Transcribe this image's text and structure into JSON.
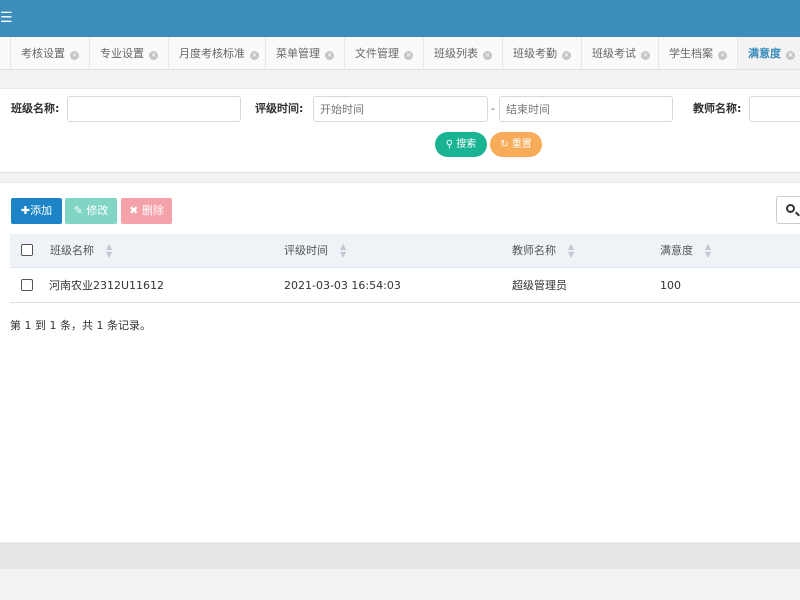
{
  "topbar": {
    "menu_icon": "☰"
  },
  "tabs": [
    {
      "label": "考核设置"
    },
    {
      "label": "专业设置"
    },
    {
      "label": "月度考核标准"
    },
    {
      "label": "菜单管理"
    },
    {
      "label": "文件管理"
    },
    {
      "label": "班级列表"
    },
    {
      "label": "班级考勤"
    },
    {
      "label": "班级考试"
    },
    {
      "label": "学生档案"
    },
    {
      "label": "满意度"
    }
  ],
  "search": {
    "class_name_label": "班级名称:",
    "class_name_value": "",
    "rating_time_label": "评级时间:",
    "start_placeholder": "开始时间",
    "separator": "-",
    "end_placeholder": "结束时间",
    "teacher_label": "教师名称:",
    "teacher_value": "",
    "search_button": "搜索",
    "reset_button": "重置"
  },
  "toolbar": {
    "add_label": "添加",
    "edit_label": "修改",
    "delete_label": "删除"
  },
  "table": {
    "columns": [
      "班级名称",
      "评级时间",
      "教师名称",
      "满意度"
    ],
    "rows": [
      {
        "class_name": "河南农业2312U11612",
        "rating_time": "2021-03-03 16:54:03",
        "teacher": "超级管理员",
        "satisfaction": "100"
      }
    ]
  },
  "pagination": {
    "info": "第 1 到 1 条，共 1 条记录。"
  },
  "colors": {
    "header": "#3c8dbc",
    "primary": "#1c84c6",
    "success": "#1ab394",
    "warning": "#f8ac59",
    "danger": "#ed5565"
  }
}
